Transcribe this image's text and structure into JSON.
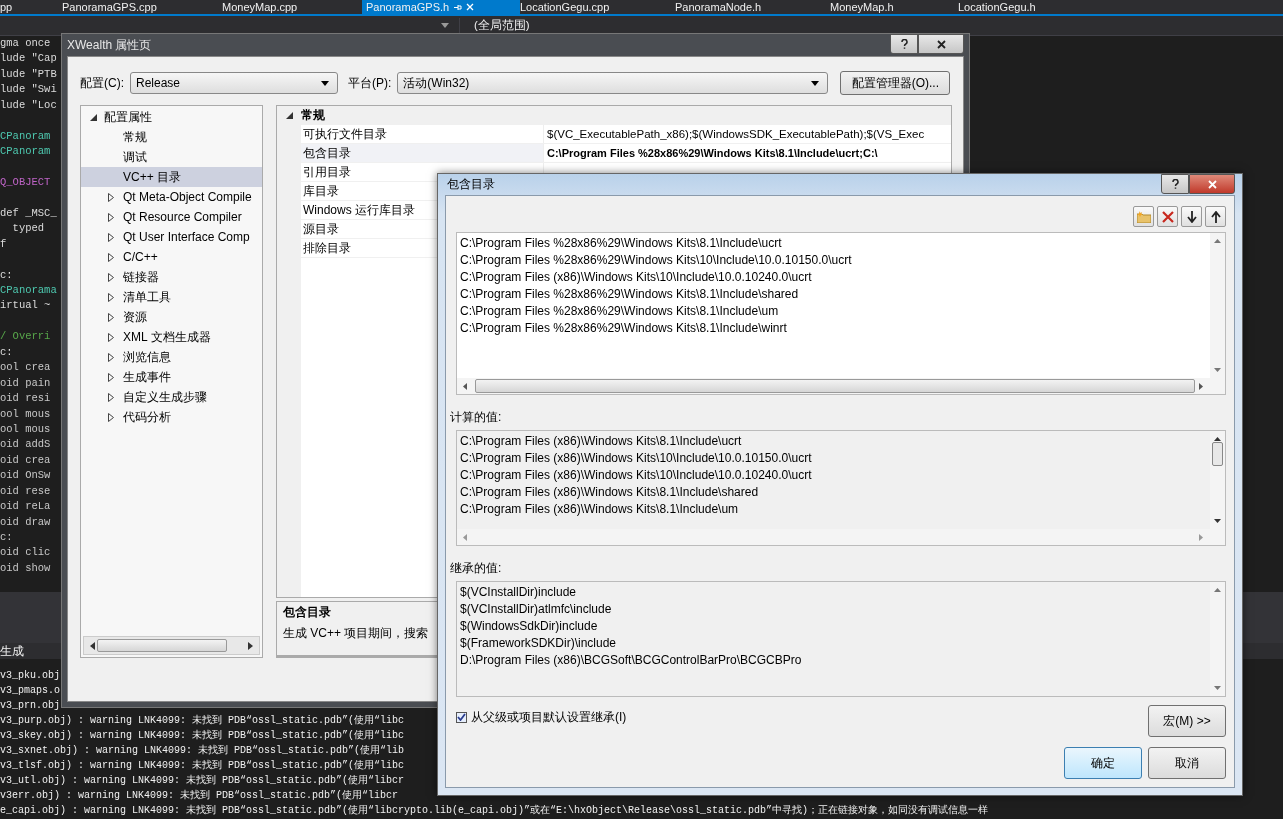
{
  "ide": {
    "tabs": [
      {
        "label": "pp",
        "selected": false
      },
      {
        "label": "PanoramaGPS.cpp",
        "selected": false
      },
      {
        "label": "MoneyMap.cpp",
        "selected": false
      },
      {
        "label": "PanoramaGPS.h",
        "selected": true
      },
      {
        "label": "LocationGegu.cpp",
        "selected": false
      },
      {
        "label": "PanoramaNode.h",
        "selected": false
      },
      {
        "label": "MoneyMap.h",
        "selected": false
      },
      {
        "label": "LocationGegu.h",
        "selected": false
      }
    ],
    "scope": "(全局范围)",
    "code_blocks": [
      [
        "gma once",
        "lude \"Cap",
        "lude \"PTB",
        "lude \"Swi",
        "lude \"Loc"
      ],
      [
        "CPanoram",
        "CPanoram"
      ],
      [
        "Q_OBJECT"
      ],
      [
        "def _MSC_",
        "  typed",
        "f"
      ],
      [
        "c:",
        "CPanorama",
        "irtual ~"
      ],
      [
        "/ Overri",
        "c:",
        "ool crea",
        "oid pain",
        "oid resi",
        "ool mous",
        "ool mous",
        "oid addS",
        "oid crea",
        "oid OnSw",
        "oid rese",
        "oid reLa",
        "oid draw",
        "c:",
        "oid clic",
        "oid show"
      ]
    ],
    "output_title": "生成",
    "output_lines": [
      "v3_pku.obj",
      "v3_pmaps.o",
      "v3_prn.obj",
      "v3_purp.obj) : warning LNK4099: 未找到 PDB“ossl_static.pdb”(使用“libc",
      "v3_skey.obj) : warning LNK4099: 未找到 PDB“ossl_static.pdb”(使用“libc",
      "v3_sxnet.obj) : warning LNK4099: 未找到 PDB“ossl_static.pdb”(使用“lib",
      "v3_tlsf.obj) : warning LNK4099: 未找到 PDB“ossl_static.pdb”(使用“libc",
      "v3_utl.obj) : warning LNK4099: 未找到 PDB“ossl_static.pdb”(使用“libcr",
      "v3err.obj) : warning LNK4099: 未找到 PDB“ossl_static.pdb”(使用“libcr",
      "e_capi.obj) : warning LNK4099: 未找到 PDB“ossl_static.pdb”(使用“libcrypto.lib(e_capi.obj)”或在“E:\\hxObject\\Release\\ossl_static.pdb”中寻找)；正在链接对象，如同没有调试信息一样"
    ]
  },
  "properties_dialog": {
    "title": "XWealth 属性页",
    "config_label": "配置(C):",
    "config_value": "Release",
    "platform_label": "平台(P):",
    "platform_value": "活动(Win32)",
    "manager_button": "配置管理器(O)...",
    "tree": [
      {
        "label": "配置属性",
        "expanded": true,
        "children": [
          {
            "label": "常规",
            "selected": false
          },
          {
            "label": "调试",
            "selected": false
          },
          {
            "label": "VC++ 目录",
            "selected": true
          },
          {
            "label": "Qt Meta-Object Compile",
            "selected": false,
            "expanded": false
          },
          {
            "label": "Qt Resource Compiler",
            "selected": false,
            "expanded": false
          },
          {
            "label": "Qt User Interface Comp",
            "selected": false,
            "expanded": false
          },
          {
            "label": "C/C++",
            "selected": false,
            "expanded": false
          },
          {
            "label": "链接器",
            "selected": false,
            "expanded": false
          },
          {
            "label": "清单工具",
            "selected": false,
            "expanded": false
          },
          {
            "label": "资源",
            "selected": false,
            "expanded": false
          },
          {
            "label": "XML 文档生成器",
            "selected": false,
            "expanded": false
          },
          {
            "label": "浏览信息",
            "selected": false,
            "expanded": false
          },
          {
            "label": "生成事件",
            "selected": false,
            "expanded": false
          },
          {
            "label": "自定义生成步骤",
            "selected": false,
            "expanded": false
          },
          {
            "label": "代码分析",
            "selected": false,
            "expanded": false
          }
        ]
      }
    ],
    "grid": {
      "category": "常规",
      "expanded": true,
      "rows": [
        {
          "name": "可执行文件目录",
          "value": "$(VC_ExecutablePath_x86);$(WindowsSDK_ExecutablePath);$(VS_Exec",
          "bold": false,
          "selected": false
        },
        {
          "name": "包含目录",
          "value": "C:\\Program Files %28x86%29\\Windows Kits\\8.1\\Include\\ucrt;C:\\",
          "bold": true,
          "selected": true
        },
        {
          "name": "引用目录",
          "selected": false
        },
        {
          "name": "库目录",
          "selected": false
        },
        {
          "name": "Windows 运行库目录",
          "selected": false
        },
        {
          "name": "源目录",
          "selected": false
        },
        {
          "name": "排除目录",
          "selected": false
        }
      ]
    },
    "description": {
      "title": "包含目录",
      "text": "生成 VC++ 项目期间，搜索"
    }
  },
  "include_dialog": {
    "title": "包含目录",
    "entries": [
      "C:\\Program Files %28x86%29\\Windows Kits\\8.1\\Include\\ucrt",
      "C:\\Program Files %28x86%29\\Windows Kits\\10\\Include\\10.0.10150.0\\ucrt",
      "C:\\Program Files (x86)\\Windows Kits\\10\\Include\\10.0.10240.0\\ucrt",
      "C:\\Program Files %28x86%29\\Windows Kits\\8.1\\Include\\shared",
      "C:\\Program Files %28x86%29\\Windows Kits\\8.1\\Include\\um",
      "C:\\Program Files %28x86%29\\Windows Kits\\8.1\\Include\\winrt"
    ],
    "computed_label": "计算的值:",
    "computed": [
      "C:\\Program Files (x86)\\Windows Kits\\8.1\\Include\\ucrt",
      "C:\\Program Files (x86)\\Windows Kits\\10\\Include\\10.0.10150.0\\ucrt",
      "C:\\Program Files (x86)\\Windows Kits\\10\\Include\\10.0.10240.0\\ucrt",
      "C:\\Program Files (x86)\\Windows Kits\\8.1\\Include\\shared",
      "C:\\Program Files (x86)\\Windows Kits\\8.1\\Include\\um"
    ],
    "inherited_label": "继承的值:",
    "inherited": [
      "$(VCInstallDir)include",
      "$(VCInstallDir)atlmfc\\include",
      "$(WindowsSdkDir)include",
      "$(FrameworkSDKDir)\\include",
      "D:\\Program Files (x86)\\BCGSoft\\BCGControlBarPro\\BCGCBPro"
    ],
    "inherit_checkbox": {
      "label": "从父级或项目默认设置继承(I)",
      "checked": true
    },
    "macros_button": "宏(M) >>",
    "ok_button": "确定",
    "cancel_button": "取消"
  }
}
